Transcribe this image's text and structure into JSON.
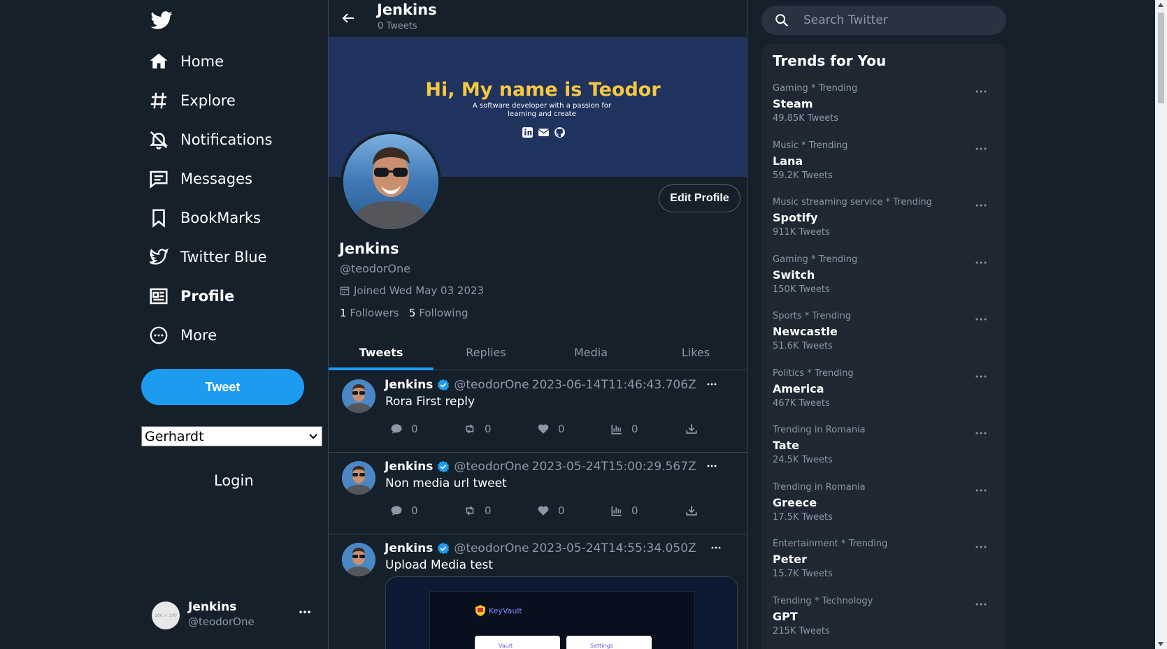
{
  "sidebar": {
    "nav": [
      {
        "label": "Home",
        "icon": "home-icon"
      },
      {
        "label": "Explore",
        "icon": "hashtag-icon"
      },
      {
        "label": "Notifications",
        "icon": "bell-icon"
      },
      {
        "label": "Messages",
        "icon": "message-icon"
      },
      {
        "label": "BookMarks",
        "icon": "bookmark-icon"
      },
      {
        "label": "Twitter Blue",
        "icon": "twitter-bird-icon"
      },
      {
        "label": "Profile",
        "icon": "profile-card-icon"
      },
      {
        "label": "More",
        "icon": "more-circle-icon"
      }
    ],
    "active": "Profile",
    "tweet_button": "Tweet",
    "user_select_value": "Gerhardt",
    "login_label": "Login",
    "account": {
      "name": "Jenkins",
      "handle": "@teodorOne",
      "avatar_placeholder": "100 × 100"
    }
  },
  "header": {
    "title": "Jenkins",
    "tweet_count": "0 Tweets"
  },
  "banner": {
    "title": "Hi, My name is Teodor",
    "subtitle": "A software developer with a passion for learning and create"
  },
  "profile": {
    "edit_label": "Edit Profile",
    "name": "Jenkins",
    "handle": "@teodorOne",
    "joined": "Joined Wed May 03 2023",
    "followers_count": "1",
    "followers_label": "Followers",
    "following_count": "5",
    "following_label": "Following"
  },
  "tabs": [
    {
      "label": "Tweets",
      "active": true
    },
    {
      "label": "Replies",
      "active": false
    },
    {
      "label": "Media",
      "active": false
    },
    {
      "label": "Likes",
      "active": false
    }
  ],
  "tweets": [
    {
      "name": "Jenkins",
      "handle": "@teodorOne",
      "date": "2023-06-14T11:46:43.706Z",
      "text": "Rora First reply",
      "replies": "0",
      "retweets": "0",
      "likes": "0",
      "views": "0"
    },
    {
      "name": "Jenkins",
      "handle": "@teodorOne",
      "date": "2023-05-24T15:00:29.567Z",
      "text": "Non media url tweet",
      "replies": "0",
      "retweets": "0",
      "likes": "0",
      "views": "0"
    },
    {
      "name": "Jenkins",
      "handle": "@teodorOne",
      "date": "2023-05-24T14:55:34.050Z",
      "text": "Upload Media test",
      "media": {
        "app_name": "KeyVault",
        "card1": "Vault",
        "card2": "Settings"
      }
    }
  ],
  "search": {
    "placeholder": "Search Twitter"
  },
  "trends": {
    "title": "Trends for You",
    "items": [
      {
        "category": "Gaming * Trending",
        "name": "Steam",
        "count": "49.85K Tweets"
      },
      {
        "category": "Music * Trending",
        "name": "Lana",
        "count": "59.2K Tweets"
      },
      {
        "category": "Music streaming service * Trending",
        "name": "Spotify",
        "count": "911K Tweets"
      },
      {
        "category": "Gaming * Trending",
        "name": "Switch",
        "count": "150K Tweets"
      },
      {
        "category": "Sports * Trending",
        "name": "Newcastle",
        "count": "51.6K Tweets"
      },
      {
        "category": "Politics * Trending",
        "name": "America",
        "count": "467K Tweets"
      },
      {
        "category": "Trending in Romania",
        "name": "Tate",
        "count": "24.5K Tweets"
      },
      {
        "category": "Trending in Romania",
        "name": "Greece",
        "count": "17.5K Tweets"
      },
      {
        "category": "Entertainment * Trending",
        "name": "Peter",
        "count": "15.7K Tweets"
      },
      {
        "category": "Trending * Technology",
        "name": "GPT",
        "count": "215K Tweets"
      }
    ]
  },
  "colors": {
    "background": "#15202b",
    "accent": "#1d9bf0",
    "banner": "#20325e",
    "banner_title": "#f5c842"
  }
}
